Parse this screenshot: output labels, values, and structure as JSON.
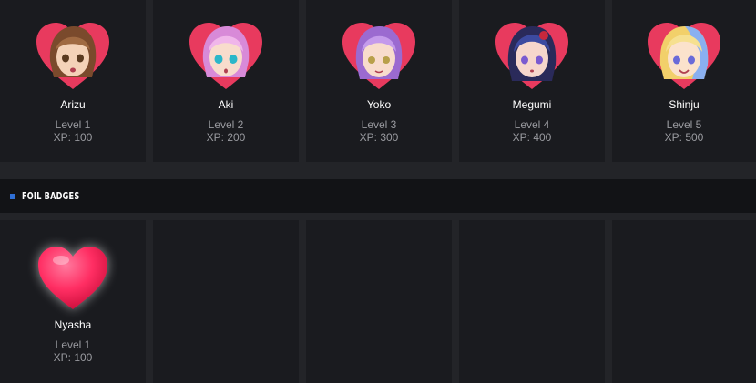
{
  "sections": {
    "foil_title": "FOIL BADGES"
  },
  "badges": [
    {
      "name": "Arizu",
      "level": "Level 1",
      "xp": "XP: 100",
      "hair": "#7a4a2c",
      "hair2": "#a06a42",
      "eyes": "#5a3a20"
    },
    {
      "name": "Aki",
      "level": "Level 2",
      "xp": "XP: 200",
      "hair": "#d88ad8",
      "hair2": "#f0b6ea",
      "eyes": "#2bb7c9"
    },
    {
      "name": "Yoko",
      "level": "Level 3",
      "xp": "XP: 300",
      "hair": "#9b6ad0",
      "hair2": "#c49aeb",
      "eyes": "#b8a04a"
    },
    {
      "name": "Megumi",
      "level": "Level 4",
      "xp": "XP: 400",
      "hair": "#2a2a5a",
      "hair2": "#3c4aa0",
      "eyes": "#7a5ad0"
    },
    {
      "name": "Shinju",
      "level": "Level 5",
      "xp": "XP: 500",
      "hair": "#f2d06a",
      "hair2": "#8ab0f0",
      "eyes": "#6a6ad8"
    }
  ],
  "foil_badges": [
    {
      "name": "Nyasha",
      "level": "Level 1",
      "xp": "XP: 100"
    }
  ],
  "colors": {
    "heart": "#e83a5e",
    "heart_dark": "#b81e44",
    "foil_heart": "#ff2e63",
    "accent": "#2f6fd6"
  }
}
